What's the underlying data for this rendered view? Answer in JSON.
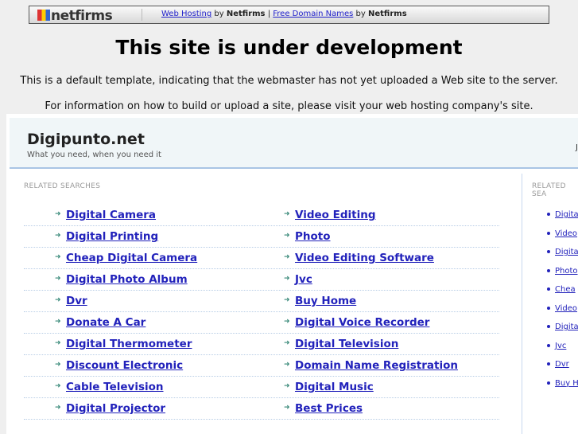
{
  "topbar": {
    "logo": "netfirms",
    "link1": "Web Hosting",
    "by1": "by",
    "brand1": "Netfirms",
    "pipe": "|",
    "link2": "Free Domain Names",
    "by2": "by",
    "brand2": "Netfirms"
  },
  "heading": "This site is under development",
  "para1": "This is a default template, indicating that the webmaster has not yet uploaded a Web site to the server.",
  "para2": "For information on how to build or upload a site, please visit your web hosting company's site.",
  "site": {
    "title": "Digipunto.net",
    "tagline": "What you need, when you need it",
    "cut_text": "Ju"
  },
  "related_label": "RELATED SEARCHES",
  "related_label_right": "RELATED SEA",
  "left_links": [
    [
      "Digital Camera",
      "Video Editing"
    ],
    [
      "Digital Printing",
      "Photo"
    ],
    [
      "Cheap Digital Camera",
      "Video Editing Software"
    ],
    [
      "Digital Photo Album",
      "Jvc"
    ],
    [
      "Dvr",
      "Buy Home"
    ],
    [
      "Donate A Car",
      "Digital Voice Recorder"
    ],
    [
      "Digital Thermometer",
      "Digital Television"
    ],
    [
      "Discount Electronic",
      "Domain Name Registration"
    ],
    [
      "Cable Television",
      "Digital Music"
    ],
    [
      "Digital Projector",
      "Best Prices"
    ]
  ],
  "right_links": [
    "Digita",
    "Video",
    "Digita",
    "Photo",
    "Chea",
    "Video",
    "Digita",
    "Jvc",
    "Dvr",
    "Buy H"
  ]
}
